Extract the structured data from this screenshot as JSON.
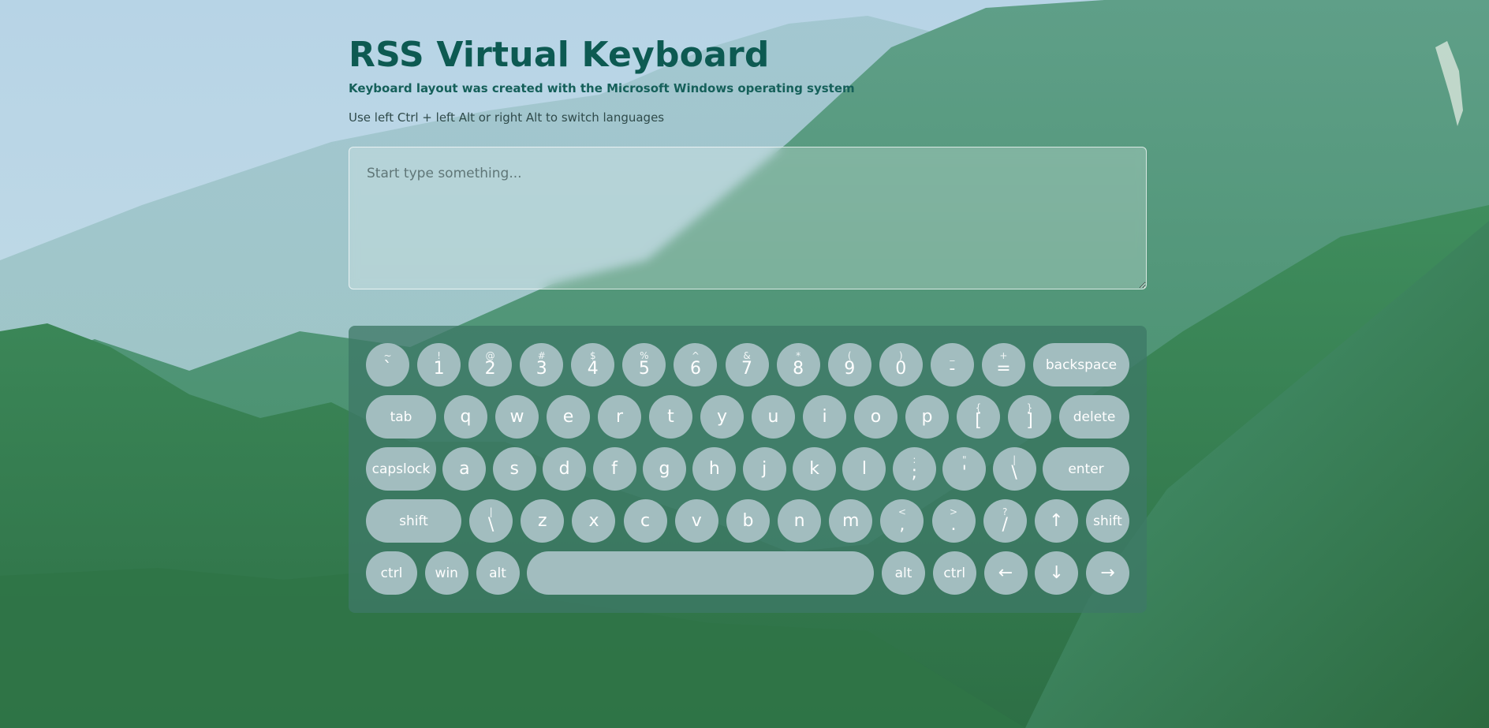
{
  "header": {
    "title": "RSS Virtual Keyboard",
    "subtitle": "Keyboard layout was created with the Microsoft Windows operating system",
    "hint": "Use left Ctrl + left Alt or right Alt to switch languages"
  },
  "textarea": {
    "placeholder": "Start type something...",
    "value": ""
  },
  "colors": {
    "title": "#0d5a52",
    "keyboard_bg": "#3e7866",
    "key_bg": "#a2bdbf",
    "key_text": "#ffffff"
  },
  "keyboard": {
    "rows": [
      [
        {
          "shift": "~",
          "main": "`"
        },
        {
          "shift": "!",
          "main": "1"
        },
        {
          "shift": "@",
          "main": "2"
        },
        {
          "shift": "#",
          "main": "3"
        },
        {
          "shift": "$",
          "main": "4"
        },
        {
          "shift": "%",
          "main": "5"
        },
        {
          "shift": "^",
          "main": "6"
        },
        {
          "shift": "&",
          "main": "7"
        },
        {
          "shift": "*",
          "main": "8"
        },
        {
          "shift": "(",
          "main": "9"
        },
        {
          "shift": ")",
          "main": "0"
        },
        {
          "shift": "_",
          "main": "-"
        },
        {
          "shift": "+",
          "main": "="
        },
        {
          "shift": "",
          "main": "backspace",
          "word": true
        }
      ],
      [
        {
          "shift": "",
          "main": "tab",
          "word": true
        },
        {
          "shift": "",
          "main": "q"
        },
        {
          "shift": "",
          "main": "w"
        },
        {
          "shift": "",
          "main": "e"
        },
        {
          "shift": "",
          "main": "r"
        },
        {
          "shift": "",
          "main": "t"
        },
        {
          "shift": "",
          "main": "y"
        },
        {
          "shift": "",
          "main": "u"
        },
        {
          "shift": "",
          "main": "i"
        },
        {
          "shift": "",
          "main": "o"
        },
        {
          "shift": "",
          "main": "p"
        },
        {
          "shift": "{",
          "main": "["
        },
        {
          "shift": "}",
          "main": "]"
        },
        {
          "shift": "",
          "main": "delete",
          "word": true
        }
      ],
      [
        {
          "shift": "",
          "main": "capslock",
          "word": true
        },
        {
          "shift": "",
          "main": "a"
        },
        {
          "shift": "",
          "main": "s"
        },
        {
          "shift": "",
          "main": "d"
        },
        {
          "shift": "",
          "main": "f"
        },
        {
          "shift": "",
          "main": "g"
        },
        {
          "shift": "",
          "main": "h"
        },
        {
          "shift": "",
          "main": "j"
        },
        {
          "shift": "",
          "main": "k"
        },
        {
          "shift": "",
          "main": "l"
        },
        {
          "shift": ":",
          "main": ";"
        },
        {
          "shift": "\"",
          "main": "'"
        },
        {
          "shift": "|",
          "main": "\\"
        },
        {
          "shift": "",
          "main": "enter",
          "word": true
        }
      ],
      [
        {
          "shift": "",
          "main": "shift",
          "word": true
        },
        {
          "shift": "|",
          "main": "\\"
        },
        {
          "shift": "",
          "main": "z"
        },
        {
          "shift": "",
          "main": "x"
        },
        {
          "shift": "",
          "main": "c"
        },
        {
          "shift": "",
          "main": "v"
        },
        {
          "shift": "",
          "main": "b"
        },
        {
          "shift": "",
          "main": "n"
        },
        {
          "shift": "",
          "main": "m"
        },
        {
          "shift": "<",
          "main": ","
        },
        {
          "shift": ">",
          "main": "."
        },
        {
          "shift": "?",
          "main": "/"
        },
        {
          "shift": "",
          "main": "↑"
        },
        {
          "shift": "",
          "main": "shift",
          "word": true
        }
      ],
      [
        {
          "shift": "",
          "main": "ctrl",
          "word": true
        },
        {
          "shift": "",
          "main": "win",
          "word": true
        },
        {
          "shift": "",
          "main": "alt",
          "word": true
        },
        {
          "shift": "",
          "main": ""
        },
        {
          "shift": "",
          "main": "alt",
          "word": true
        },
        {
          "shift": "",
          "main": "ctrl",
          "word": true
        },
        {
          "shift": "",
          "main": "←"
        },
        {
          "shift": "",
          "main": "↓"
        },
        {
          "shift": "",
          "main": "→"
        }
      ]
    ]
  }
}
